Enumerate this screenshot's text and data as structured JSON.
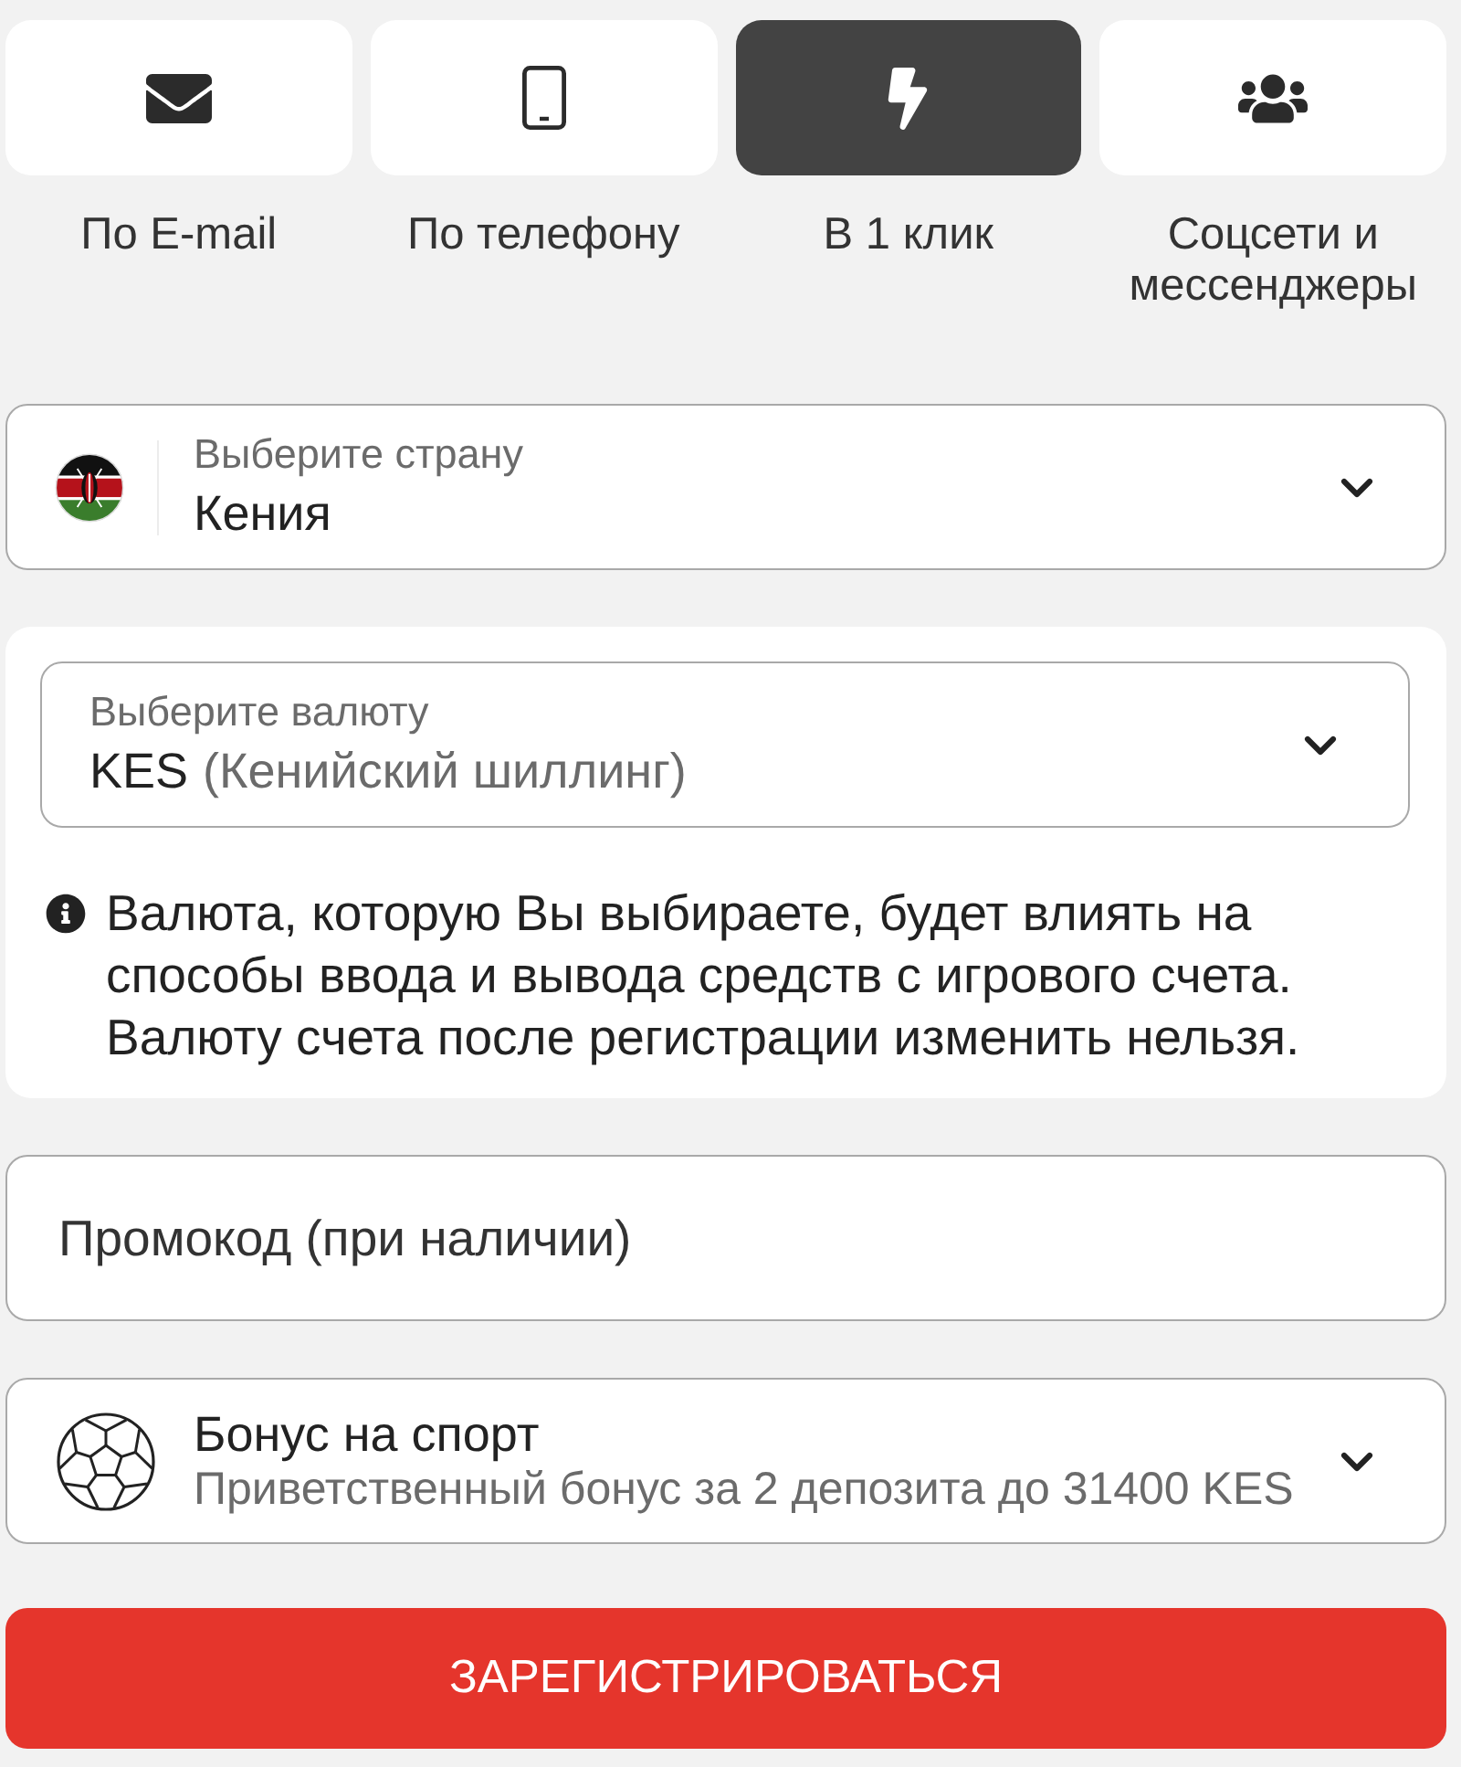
{
  "registration_tabs": [
    {
      "kind": "email",
      "label": "По E-mail",
      "selected": false
    },
    {
      "kind": "phone",
      "label": "По телефону",
      "selected": false
    },
    {
      "kind": "one_click",
      "label": "В 1 клик",
      "selected": true
    },
    {
      "kind": "social",
      "label": "Соцсети и мессенджеры",
      "selected": false
    }
  ],
  "country_select": {
    "label": "Выберите страну",
    "value": "Кения"
  },
  "currency_select": {
    "label": "Выберите валюту",
    "code": "KES",
    "name": "(Кенийский шиллинг)"
  },
  "currency_note": "Валюта, которую Вы выбираете, будет влиять на способы ввода и вывода средств с игрового счета. Валюту счета после регистрации изменить нельзя.",
  "promo_code": {
    "placeholder": "Промокод (при наличии)"
  },
  "bonus_select": {
    "title": "Бонус на спорт",
    "description": "Приветственный бонус за 2 депозита до 31400 KES"
  },
  "register_button": "ЗАРЕГИСТРИРОВАТЬСЯ"
}
